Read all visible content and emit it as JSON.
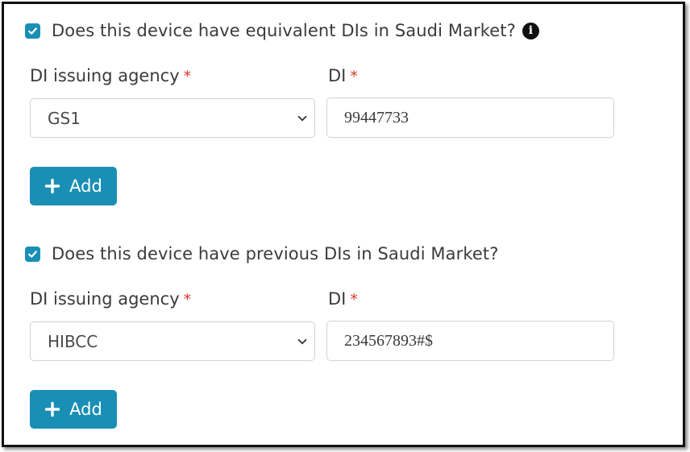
{
  "equivalent_section": {
    "checkbox_checked": true,
    "question": "Does this device have equivalent DIs in Saudi Market?",
    "info_icon": "info-circle-icon",
    "agency_label": "DI issuing agency",
    "agency_required_mark": "*",
    "agency_value": "GS1",
    "di_label": "DI",
    "di_required_mark": "*",
    "di_value": "99447733",
    "add_label": "Add"
  },
  "previous_section": {
    "checkbox_checked": true,
    "question": "Does this device have previous DIs in Saudi Market?",
    "agency_label": "DI issuing agency",
    "agency_required_mark": "*",
    "agency_value": "HIBCC",
    "di_label": "DI",
    "di_required_mark": "*",
    "di_value": "234567893#$",
    "add_label": "Add"
  },
  "colors": {
    "accent": "#1a8fb5",
    "required": "#e0352b",
    "border": "#cfd3d7",
    "text": "#3b3b3b"
  }
}
